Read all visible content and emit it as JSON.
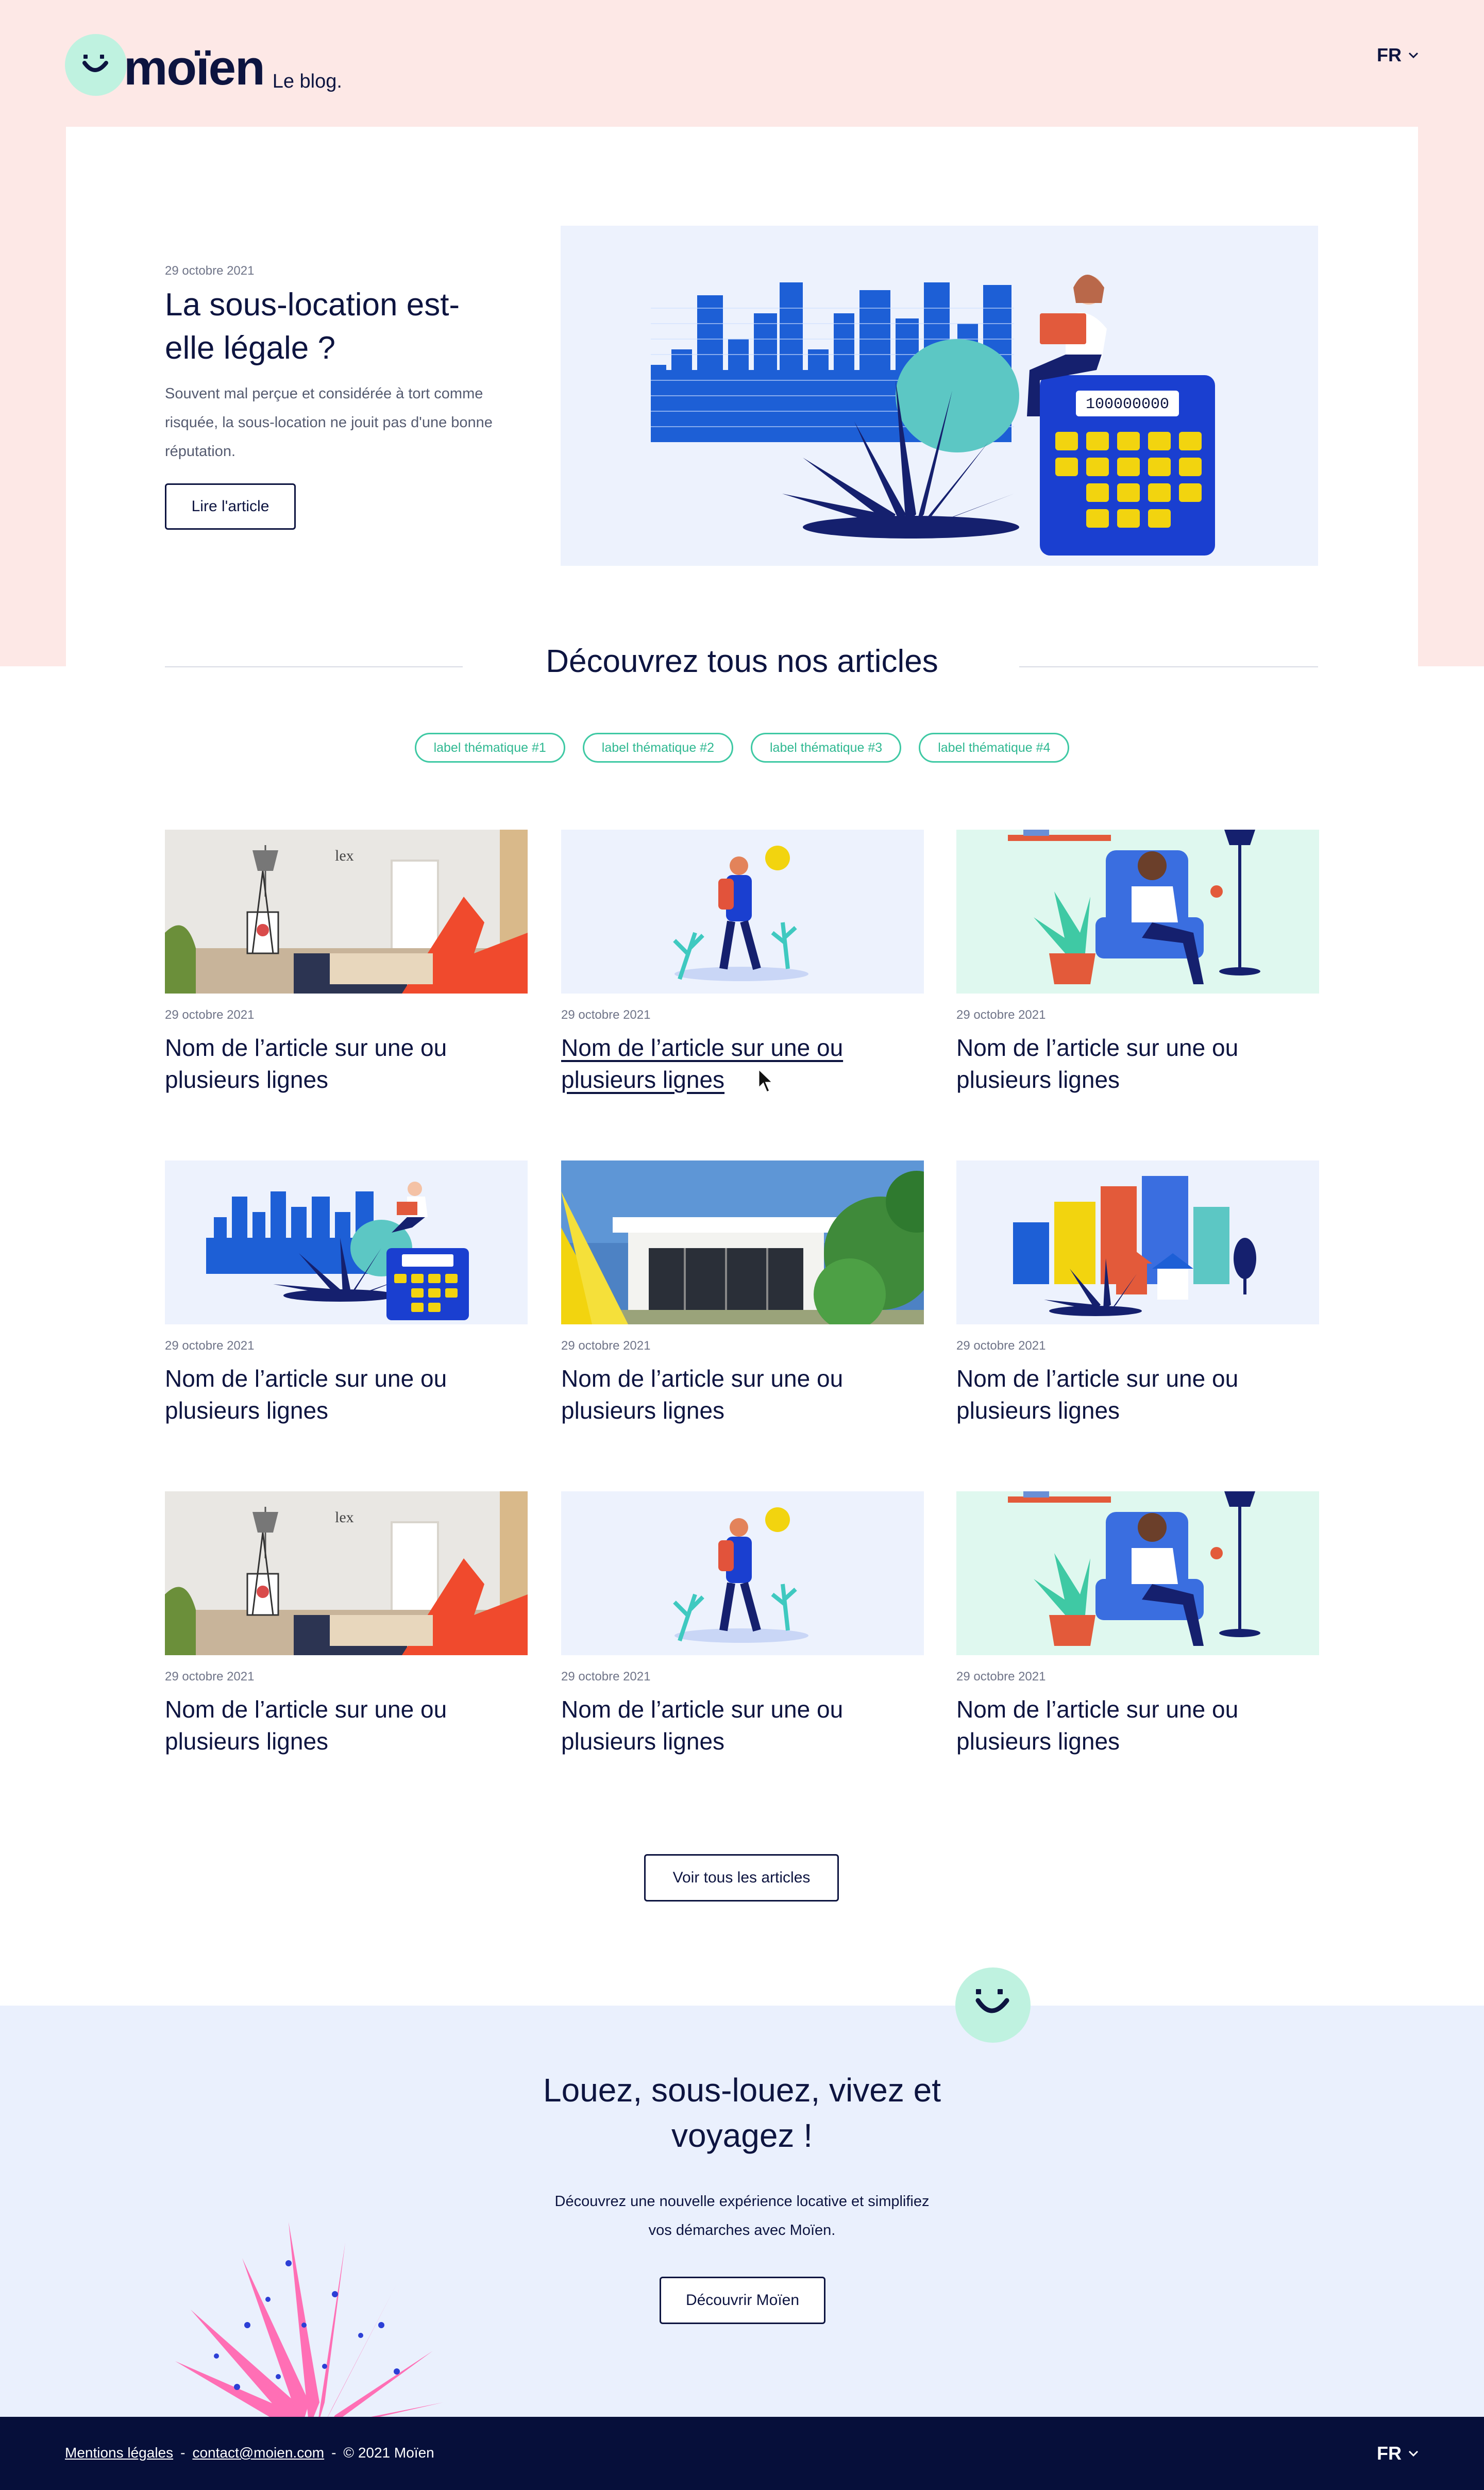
{
  "header": {
    "logo_word": "moïen",
    "logo_sub": "Le blog.",
    "lang": "FR"
  },
  "hero": {
    "date": "29 octobre 2021",
    "title": "La sous-location est-elle légale ?",
    "description": "Souvent mal perçue et considérée à tort comme risquée, la sous-location ne jouit pas d'une bonne réputation.",
    "button": "Lire l'article",
    "calculator_display": "100000000"
  },
  "section": {
    "title": "Découvrez tous nos articles"
  },
  "tags": [
    "label thématique #1",
    "label thématique #2",
    "label thématique #3",
    "label thématique #4"
  ],
  "articles": [
    {
      "date": "29 octobre 2021",
      "title": "Nom de l’article sur une ou plusieurs lignes",
      "image": "room-photo"
    },
    {
      "date": "29 octobre 2021",
      "title": "Nom de l’article sur une ou plusieurs lignes",
      "image": "hiker-illustration"
    },
    {
      "date": "29 octobre 2021",
      "title": "Nom de l’article sur une ou plusieurs lignes",
      "image": "armchair-illustration"
    },
    {
      "date": "29 octobre 2021",
      "title": "Nom de l’article sur une ou plusieurs lignes",
      "image": "calculator-illustration"
    },
    {
      "date": "29 octobre 2021",
      "title": "Nom de l’article sur une ou plusieurs lignes",
      "image": "house-photo"
    },
    {
      "date": "29 octobre 2021",
      "title": "Nom de l’article sur une ou plusieurs lignes",
      "image": "city-illustration"
    },
    {
      "date": "29 octobre 2021",
      "title": "Nom de l’article sur une ou plusieurs lignes",
      "image": "room-photo"
    },
    {
      "date": "29 octobre 2021",
      "title": "Nom de l’article sur une ou plusieurs lignes",
      "image": "hiker-illustration"
    },
    {
      "date": "29 octobre 2021",
      "title": "Nom de l’article sur une ou plusieurs lignes",
      "image": "armchair-illustration"
    }
  ],
  "all_articles_button": "Voir tous les articles",
  "cta": {
    "title_line1": "Louez, sous-louez, vivez et",
    "title_line2": "voyagez !",
    "text_line1": "Découvrez une nouvelle expérience locative et simplifiez",
    "text_line2": "vos démarches avec Moïen.",
    "button": "Découvrir Moïen"
  },
  "footer": {
    "legal": "Mentions légales",
    "separator": "-",
    "email": "contact@moien.com",
    "copyright": "© 2021 Moïen",
    "lang": "FR"
  },
  "colors": {
    "navy": "#0d1440",
    "pink_band": "#fde8e6",
    "blue_band": "#eaf0fd",
    "mint": "#bff2e0",
    "tag_green": "#3fc9a4",
    "footer": "#060f3a",
    "illustration_blue": "#1d5fd6",
    "illustration_yellow": "#f2d40f"
  }
}
